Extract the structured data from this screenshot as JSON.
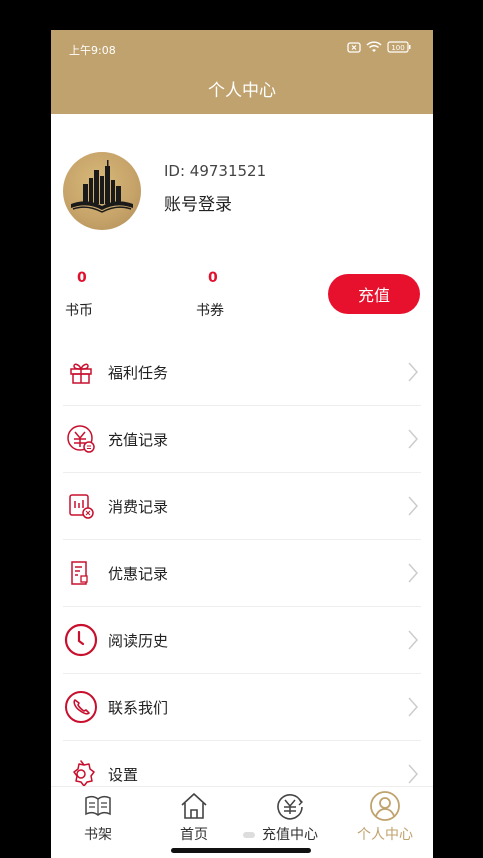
{
  "status_bar": {
    "time": "上午9:08",
    "battery": "100"
  },
  "header": {
    "title": "个人中心"
  },
  "profile": {
    "id_text": "ID: 49731521",
    "login_text": "账号登录"
  },
  "stats": [
    {
      "value": "0",
      "label": "书币"
    },
    {
      "value": "0",
      "label": "书券"
    }
  ],
  "recharge_button": "充值",
  "menu": [
    {
      "label": "福利任务",
      "icon": "gift-icon"
    },
    {
      "label": "充值记录",
      "icon": "yuan-record-icon"
    },
    {
      "label": "消费记录",
      "icon": "consume-record-icon"
    },
    {
      "label": "优惠记录",
      "icon": "coupon-record-icon"
    },
    {
      "label": "阅读历史",
      "icon": "clock-icon"
    },
    {
      "label": "联系我们",
      "icon": "phone-icon"
    },
    {
      "label": "设置",
      "icon": "gear-icon"
    }
  ],
  "tabbar": [
    {
      "label": "书架",
      "icon": "book-icon"
    },
    {
      "label": "首页",
      "icon": "home-icon"
    },
    {
      "label": "充值中心",
      "icon": "yuan-icon"
    },
    {
      "label": "个人中心",
      "icon": "user-icon"
    }
  ],
  "colors": {
    "header": "#c0a26e",
    "accent": "#e8112d",
    "active_tab": "#c0a26e"
  }
}
